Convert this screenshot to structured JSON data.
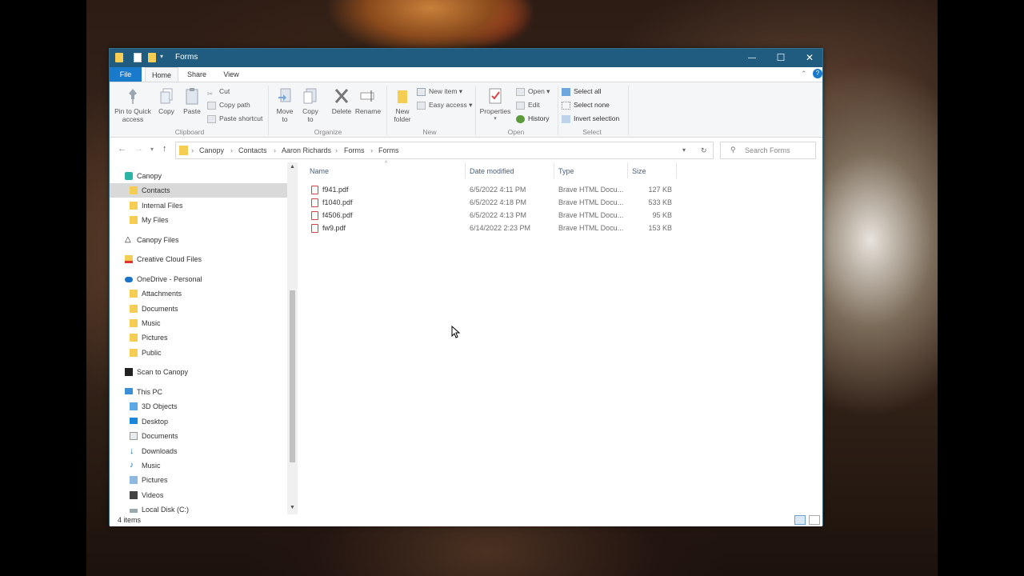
{
  "window": {
    "title": "Forms",
    "controls": {
      "minimize": "—",
      "maximize": "☐",
      "close": "✕"
    }
  },
  "tabs": [
    "File",
    "Home",
    "Share",
    "View"
  ],
  "ribbon": {
    "clipboard": {
      "pin": "Pin to Quick access",
      "copy": "Copy",
      "paste": "Paste",
      "cut": "Cut",
      "copy_path": "Copy path",
      "paste_shortcut": "Paste shortcut",
      "label": "Clipboard"
    },
    "organize": {
      "move_to": "Move to",
      "copy_to": "Copy to",
      "delete": "Delete",
      "rename": "Rename",
      "label": "Organize"
    },
    "new": {
      "new_folder": "New folder",
      "new_item": "New item",
      "easy_access": "Easy access",
      "label": "New"
    },
    "open": {
      "properties": "Properties",
      "open": "Open",
      "edit": "Edit",
      "history": "History",
      "label": "Open"
    },
    "select": {
      "select_all": "Select all",
      "select_none": "Select none",
      "invert": "Invert selection",
      "label": "Select"
    }
  },
  "address": {
    "crumbs": [
      "Canopy",
      "Contacts",
      "Aaron Richards",
      "Forms",
      "Forms"
    ],
    "search_placeholder": "Search Forms"
  },
  "nav_items": [
    {
      "label": "Canopy",
      "icon": "canopy-icon"
    },
    {
      "label": "Contacts",
      "icon": "folder-icon"
    },
    {
      "label": "Internal Files",
      "icon": "folder-icon"
    },
    {
      "label": "My Files",
      "icon": "folder-icon"
    },
    {
      "label": "Canopy Files",
      "icon": "canopy-logo-icon"
    },
    {
      "label": "Creative Cloud Files",
      "icon": "creative-cloud-icon"
    },
    {
      "label": "OneDrive - Personal",
      "icon": "onedrive-icon"
    },
    {
      "label": "Attachments",
      "icon": "folder-icon"
    },
    {
      "label": "Documents",
      "icon": "folder-icon"
    },
    {
      "label": "Music",
      "icon": "folder-icon"
    },
    {
      "label": "Pictures",
      "icon": "folder-icon"
    },
    {
      "label": "Public",
      "icon": "folder-icon"
    },
    {
      "label": "Scan to Canopy",
      "icon": "canopy-logo-icon"
    },
    {
      "label": "This PC",
      "icon": "computer-icon"
    },
    {
      "label": "3D Objects",
      "icon": "3d-objects-icon"
    },
    {
      "label": "Desktop",
      "icon": "desktop-icon"
    },
    {
      "label": "Documents",
      "icon": "documents-icon"
    },
    {
      "label": "Downloads",
      "icon": "downloads-icon"
    },
    {
      "label": "Music",
      "icon": "music-icon"
    },
    {
      "label": "Pictures",
      "icon": "pictures-icon"
    },
    {
      "label": "Videos",
      "icon": "videos-icon"
    },
    {
      "label": "Local Disk (C:)",
      "icon": "drive-icon"
    }
  ],
  "columns": [
    "Name",
    "Date modified",
    "Type",
    "Size"
  ],
  "files": [
    {
      "name": "f941.pdf",
      "date": "6/5/2022 4:11 PM",
      "type": "Brave HTML Docu...",
      "size": "127 KB"
    },
    {
      "name": "f1040.pdf",
      "date": "6/5/2022 4:18 PM",
      "type": "Brave HTML Docu...",
      "size": "533 KB"
    },
    {
      "name": "f4506.pdf",
      "date": "6/5/2022 4:13 PM",
      "type": "Brave HTML Docu...",
      "size": "95 KB"
    },
    {
      "name": "fw9.pdf",
      "date": "6/14/2022 2:23 PM",
      "type": "Brave HTML Docu...",
      "size": "153 KB"
    }
  ],
  "status": {
    "count": "4 items"
  },
  "colors": {
    "titlebar": "#1f5c80",
    "file_tab": "#1979ca",
    "folder": "#f4cd52"
  }
}
